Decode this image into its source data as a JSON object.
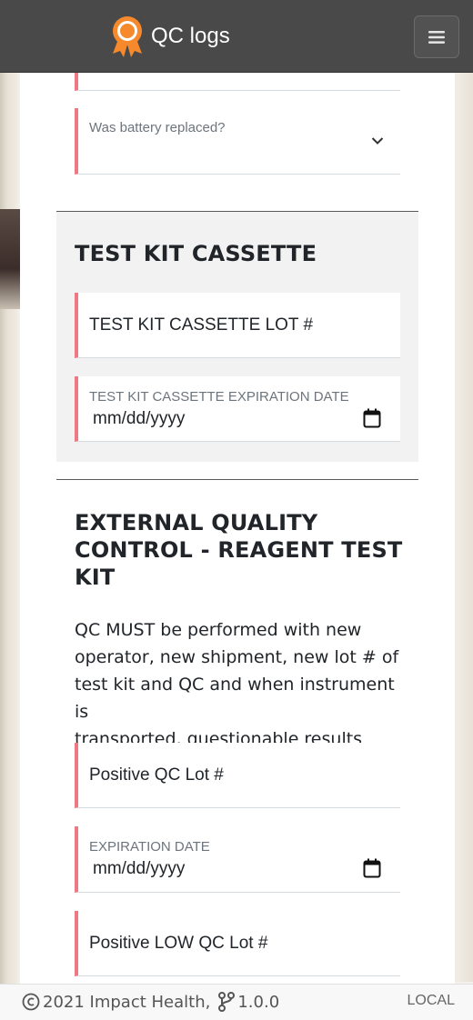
{
  "app": {
    "title": "QC logs"
  },
  "fields": {
    "battery_replaced": {
      "label": "Was battery replaced?"
    },
    "cassette_lot": {
      "placeholder": "TEST KIT CASSETTE LOT #"
    },
    "cassette_expiration": {
      "label": "TEST KIT CASSETTE EXPIRATION DATE",
      "placeholder": "mm/dd/yyyy"
    },
    "positive_qc_lot": {
      "placeholder": "Positive QC Lot #"
    },
    "expiration_date": {
      "label": "EXPIRATION DATE",
      "placeholder": "mm/dd/yyyy"
    },
    "positive_low_qc_lot": {
      "placeholder": "Positive LOW QC Lot #"
    }
  },
  "sections": {
    "cassette": {
      "title": "TEST KIT CASSETTE"
    },
    "external": {
      "title_lines": [
        "EXTERNAL QUALITY",
        "CONTROL - REAGENT TEST",
        "KIT"
      ],
      "description_lines": [
        "QC MUST be performed with new",
        "operator, new shipment, new lot # of",
        "test kit and QC and when instrument is",
        "transported, questionable results"
      ]
    }
  },
  "footer": {
    "copyright": "2021 Impact Health,",
    "version": "1.0.0",
    "env": "LOCAL"
  },
  "colors": {
    "navbar": "#494949",
    "brand_icon": "#f5892c",
    "field_accent": "#f07885"
  }
}
